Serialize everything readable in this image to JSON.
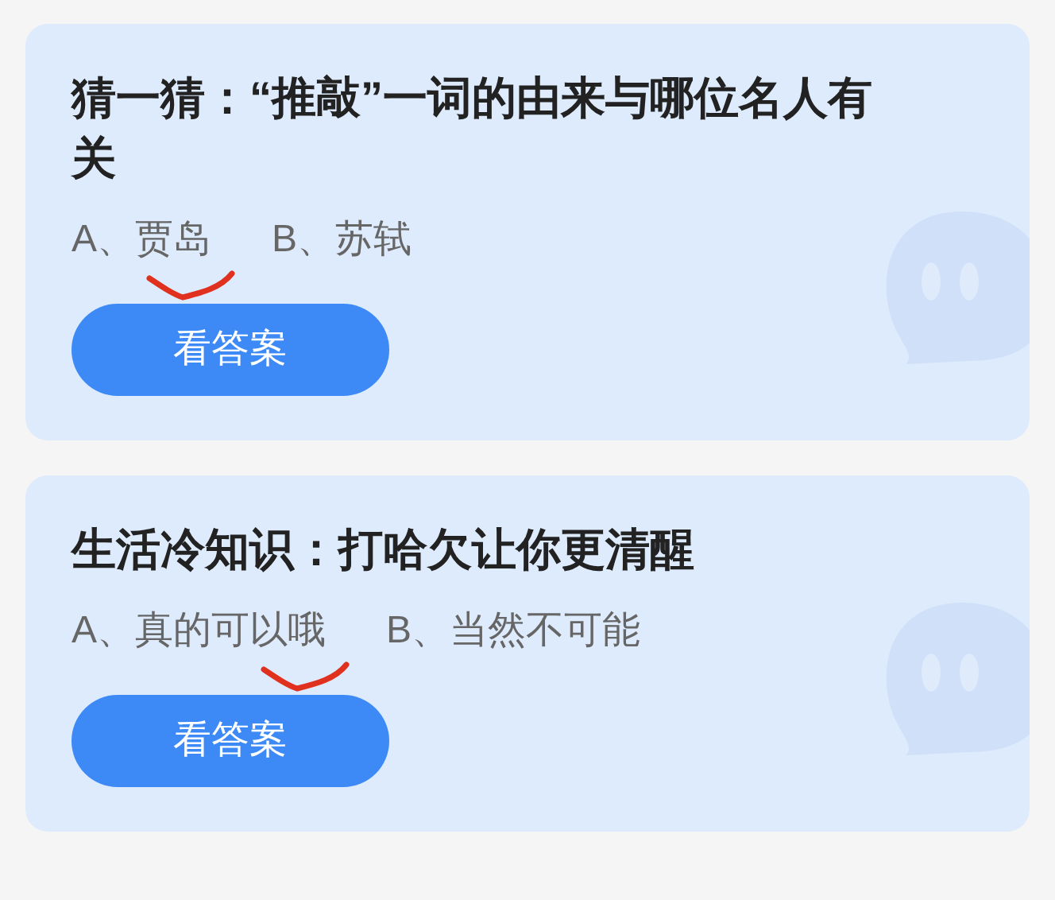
{
  "cards": [
    {
      "title": "猜一猜：“推敲”一词的由来与哪位名人有关",
      "options": [
        {
          "text": "A、贾岛",
          "marked": true
        },
        {
          "text": "B、苏轼",
          "marked": false
        }
      ],
      "button": "看答案"
    },
    {
      "title": "生活冷知识：打哈欠让你更清醒",
      "options": [
        {
          "text": "A、真的可以哦",
          "marked": true
        },
        {
          "text": "B、当然不可能",
          "marked": false
        }
      ],
      "button": "看答案"
    }
  ]
}
